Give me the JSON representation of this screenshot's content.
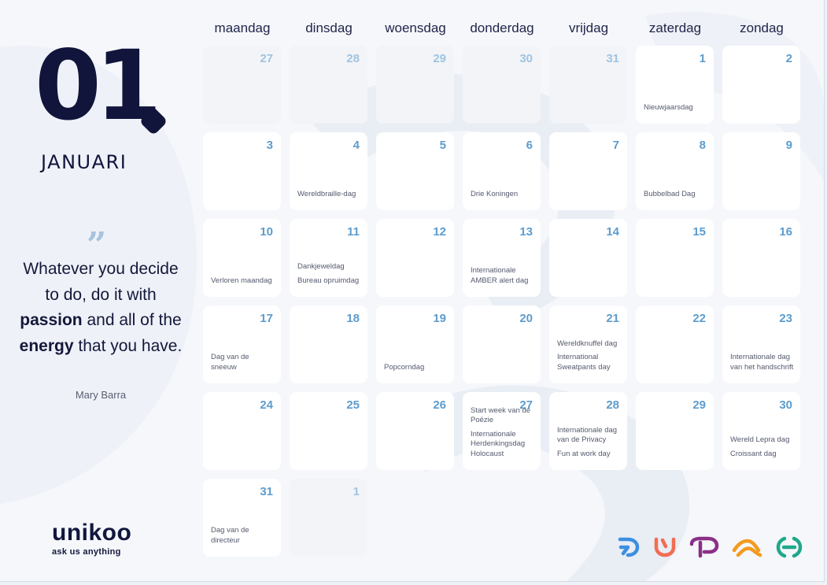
{
  "month": {
    "number": "01",
    "name": "JANUARI"
  },
  "quote": {
    "mark": "”",
    "part1": "Whatever you decide to do, do it with ",
    "bold1": "passion",
    "part2": " and all of the ",
    "bold2": "energy",
    "part3": " that you have.",
    "author": "Mary Barra"
  },
  "logo": {
    "word": "unikoo",
    "tagline": "ask us anything"
  },
  "weekdays": [
    "maandag",
    "dinsdag",
    "woensdag",
    "donderdag",
    "vrijdag",
    "zaterdag",
    "zondag"
  ],
  "weeks": [
    [
      {
        "day": "27",
        "dim": true,
        "events": []
      },
      {
        "day": "28",
        "dim": true,
        "events": []
      },
      {
        "day": "29",
        "dim": true,
        "events": []
      },
      {
        "day": "30",
        "dim": true,
        "events": []
      },
      {
        "day": "31",
        "dim": true,
        "events": []
      },
      {
        "day": "1",
        "events": [
          "Nieuwjaarsdag"
        ]
      },
      {
        "day": "2",
        "events": []
      }
    ],
    [
      {
        "day": "3",
        "events": []
      },
      {
        "day": "4",
        "events": [
          "Wereldbraille-dag"
        ]
      },
      {
        "day": "5",
        "events": []
      },
      {
        "day": "6",
        "events": [
          "Drie Koningen"
        ]
      },
      {
        "day": "7",
        "events": []
      },
      {
        "day": "8",
        "events": [
          "Bubbelbad Dag"
        ]
      },
      {
        "day": "9",
        "events": []
      }
    ],
    [
      {
        "day": "10",
        "events": [
          "Verloren maandag"
        ]
      },
      {
        "day": "11",
        "events": [
          "Dankjeweldag",
          "Bureau opruimdag"
        ]
      },
      {
        "day": "12",
        "events": []
      },
      {
        "day": "13",
        "events": [
          "Internationale AMBER alert dag"
        ]
      },
      {
        "day": "14",
        "events": []
      },
      {
        "day": "15",
        "events": []
      },
      {
        "day": "16",
        "events": []
      }
    ],
    [
      {
        "day": "17",
        "events": [
          "Dag van de sneeuw"
        ]
      },
      {
        "day": "18",
        "events": []
      },
      {
        "day": "19",
        "events": [
          "Popcorndag"
        ]
      },
      {
        "day": "20",
        "events": []
      },
      {
        "day": "21",
        "events": [
          "Wereldknuffel dag",
          "International Sweatpants day"
        ]
      },
      {
        "day": "22",
        "events": []
      },
      {
        "day": "23",
        "events": [
          "Internationale dag van het handschrift"
        ]
      }
    ],
    [
      {
        "day": "24",
        "events": []
      },
      {
        "day": "25",
        "events": []
      },
      {
        "day": "26",
        "events": []
      },
      {
        "day": "27",
        "events": [
          "Start week van de Poëzie",
          "Internationale Herdenkingsdag Holocaust"
        ]
      },
      {
        "day": "28",
        "events": [
          "Internationale dag van de Privacy",
          "Fun at work day"
        ]
      },
      {
        "day": "29",
        "events": []
      },
      {
        "day": "30",
        "events": [
          "Wereld Lepra dag",
          "Croissant dag"
        ]
      }
    ],
    [
      {
        "day": "31",
        "events": [
          "Dag van de directeur"
        ]
      },
      {
        "day": "1",
        "dim": true,
        "events": []
      }
    ]
  ],
  "brand_icons": [
    {
      "name": "blue-brand-icon",
      "color": "#3d8fe0"
    },
    {
      "name": "orange-u-brand-icon",
      "color": "#f26d52"
    },
    {
      "name": "purple-brand-icon",
      "color": "#8b2f86"
    },
    {
      "name": "orange-wave-brand-icon",
      "color": "#f39a1e"
    },
    {
      "name": "green-brand-icon",
      "color": "#1fa88a"
    }
  ]
}
